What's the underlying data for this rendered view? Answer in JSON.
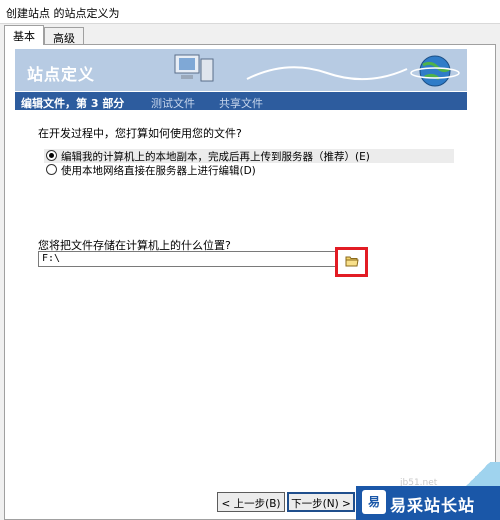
{
  "window": {
    "title": "创建站点 的站点定义为"
  },
  "tabs": [
    {
      "label": "基本",
      "active": true
    },
    {
      "label": "高级",
      "active": false
    }
  ],
  "banner": {
    "title": "站点定义"
  },
  "steps": {
    "current": "编辑文件，第 3 部分",
    "test": "测试文件",
    "share": "共享文件"
  },
  "edit_mode": {
    "question": "在开发过程中，您打算如何使用您的文件?",
    "options": [
      {
        "label": "编辑我的计算机上的本地副本，完成后再上传到服务器（推荐）(E)",
        "selected": true
      },
      {
        "label": "使用本地网络直接在服务器上进行编辑(D)",
        "selected": false
      }
    ]
  },
  "location": {
    "question": "您将把文件存储在计算机上的什么位置?",
    "path_value": "F:\\",
    "browse_icon": "folder-icon"
  },
  "buttons": {
    "prev": "< 上一步(B)",
    "next": "下一步(N) >"
  },
  "watermark": {
    "text": "易采站长站",
    "logo": "易",
    "url": "jb51.net"
  },
  "colors": {
    "step_bar": "#2d5c9e",
    "banner": "#b7cbe3",
    "highlight_border": "#e21c24",
    "watermark": "#1a57a8"
  }
}
